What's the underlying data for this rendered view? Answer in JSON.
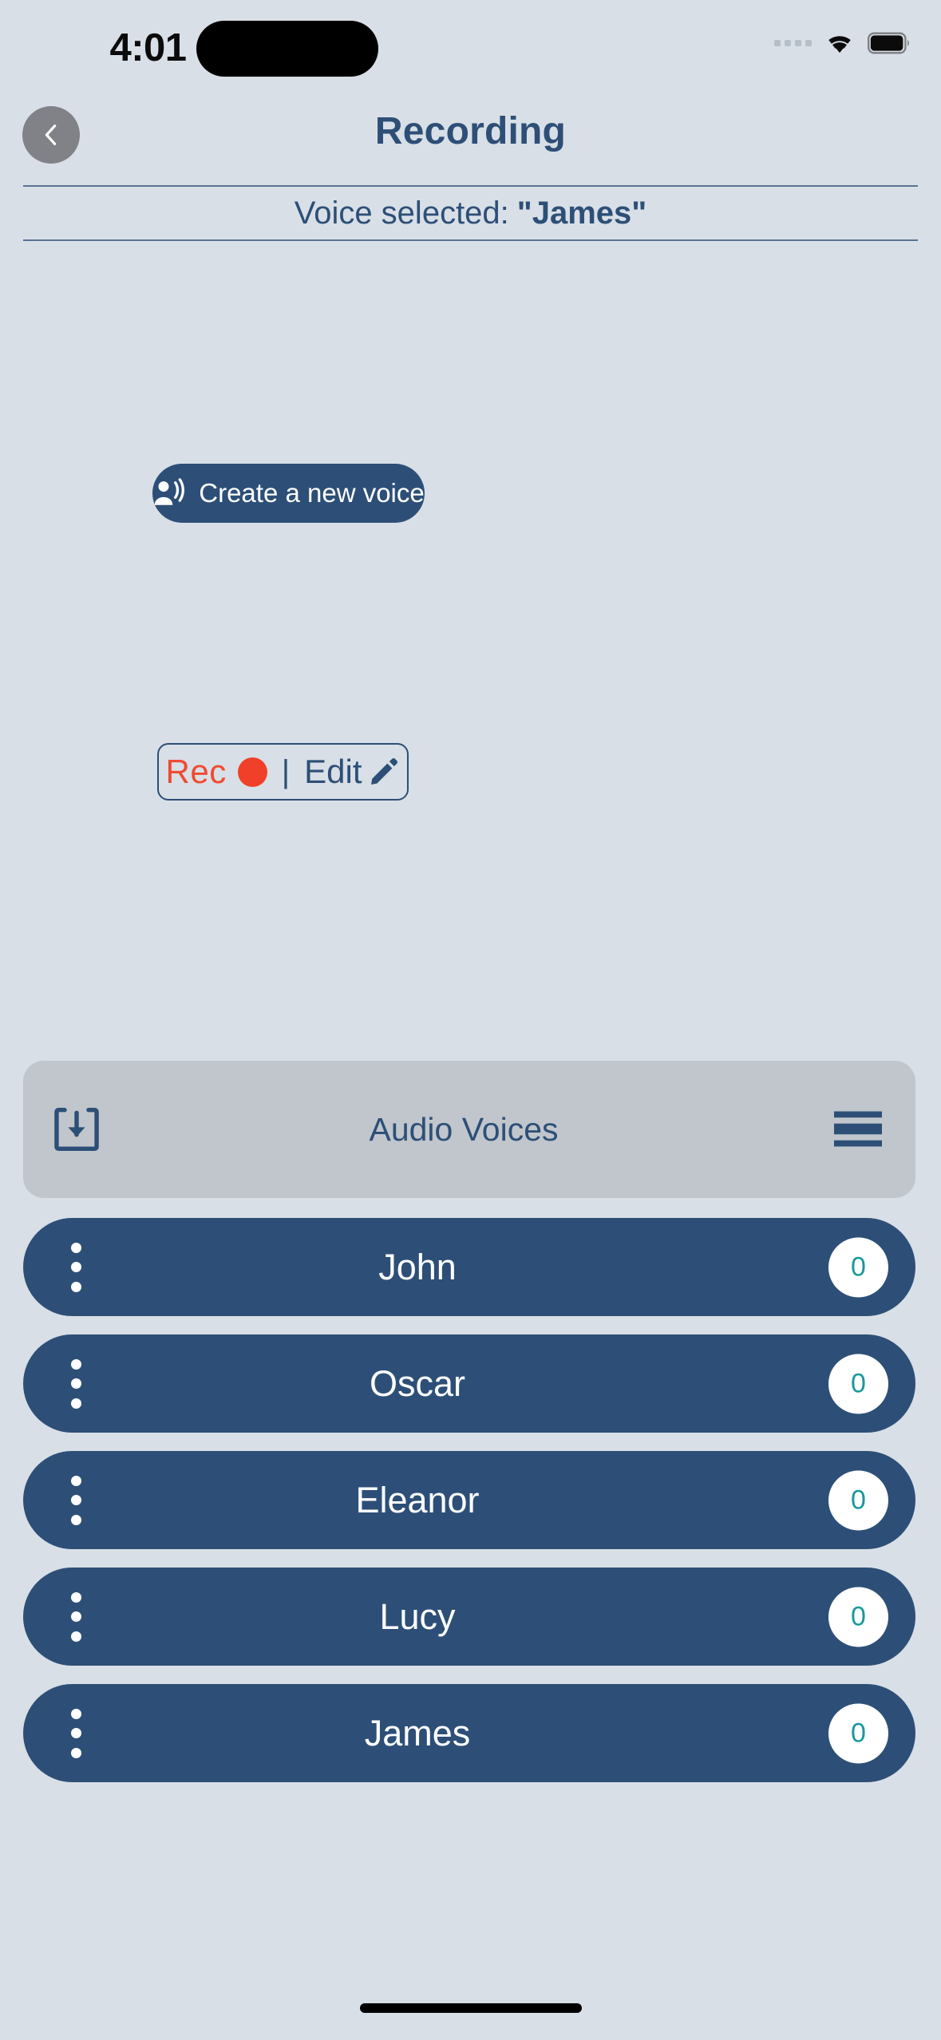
{
  "status_bar": {
    "time": "4:01",
    "signal_icon": "signal-dots-icon",
    "wifi_icon": "wifi-icon",
    "battery_icon": "battery-icon",
    "dynamic_island": "dynamic-island"
  },
  "header": {
    "back_icon": "chevron-left-icon",
    "title": "Recording"
  },
  "voice_selected": {
    "label": "Voice selected:",
    "value": "\"James\""
  },
  "create_button": {
    "label": "Create a new voice",
    "icon": "record-voice-over-icon"
  },
  "rec_edit": {
    "rec_label": "Rec",
    "rec_dot_icon": "record-dot-icon",
    "separator": "|",
    "edit_label": "Edit",
    "edit_icon": "pencil-icon"
  },
  "audio_voices_bar": {
    "import_icon": "import-download-icon",
    "title": "Audio Voices",
    "menu_icon": "hamburger-menu-icon"
  },
  "voices": [
    {
      "name": "John",
      "count": "0",
      "menu_icon": "kebab-menu-icon"
    },
    {
      "name": "Oscar",
      "count": "0",
      "menu_icon": "kebab-menu-icon"
    },
    {
      "name": "Eleanor",
      "count": "0",
      "menu_icon": "kebab-menu-icon"
    },
    {
      "name": "Lucy",
      "count": "0",
      "menu_icon": "kebab-menu-icon"
    },
    {
      "name": "James",
      "count": "0",
      "menu_icon": "kebab-menu-icon"
    }
  ],
  "colors": {
    "background": "#d8dfe6",
    "primary_navy": "#2d4f77",
    "accent_red": "#f0402a",
    "badge_teal": "#18999c",
    "bar_gray": "#c0c6cc",
    "back_button_gray": "#808287"
  }
}
